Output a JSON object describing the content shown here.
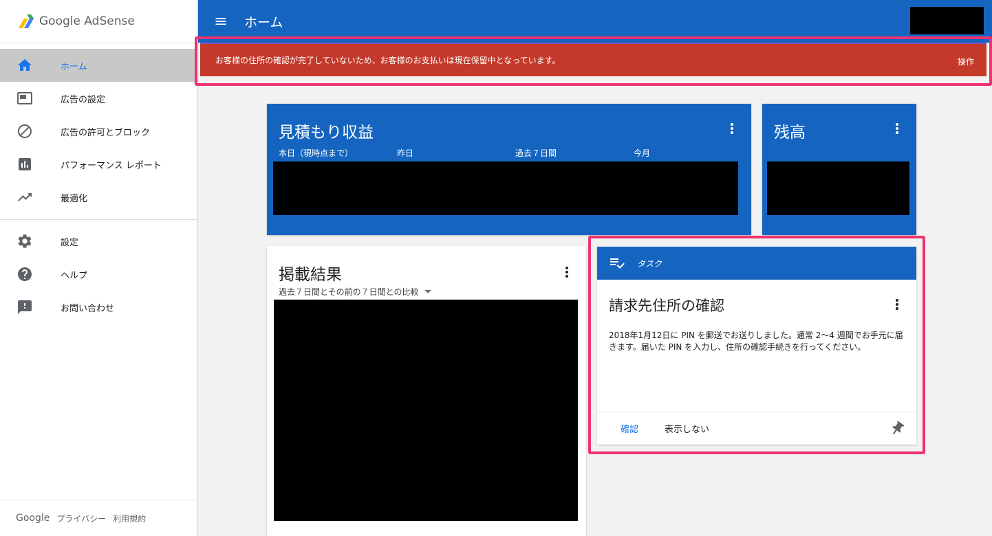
{
  "app": {
    "name": "Google AdSense"
  },
  "sidebar": {
    "items": [
      {
        "label": "ホーム",
        "icon": "home-icon",
        "active": true
      },
      {
        "label": "広告の設定",
        "icon": "ad-units-icon"
      },
      {
        "label": "広告の許可とブロック",
        "icon": "block-icon"
      },
      {
        "label": "パフォーマンス レポート",
        "icon": "bar-chart-icon"
      },
      {
        "label": "最適化",
        "icon": "trending-up-icon"
      },
      {
        "label": "設定",
        "icon": "gear-icon"
      },
      {
        "label": "ヘルプ",
        "icon": "help-icon"
      },
      {
        "label": "お問い合わせ",
        "icon": "feedback-icon"
      }
    ],
    "footer": {
      "google": "Google",
      "privacy": "プライバシー",
      "terms": "利用規約"
    }
  },
  "header": {
    "title": "ホーム"
  },
  "alert": {
    "text": "お客様の住所の確認が完了していないため、お客様のお支払いは現在保留中となっています。",
    "action": "操作",
    "color": "#c5392a"
  },
  "cards": {
    "estimated": {
      "title": "見積もり収益",
      "columns": [
        "本日（現時点まで）",
        "昨日",
        "過去７日間",
        "今月"
      ]
    },
    "balance": {
      "title": "残高"
    },
    "performance": {
      "title": "掲載結果",
      "subtitle": "過去７日間とその前の７日間との比較"
    },
    "task": {
      "header": "タスク",
      "title": "請求先住所の確認",
      "body": "2018年1月12日に PIN を郵送でお送りしました。通常 2〜4 週間でお手元に届きます。届いた PIN を入力し、住所の確認手続きを行ってください。",
      "confirm": "確認",
      "dismiss": "表示しない"
    }
  },
  "colors": {
    "primary": "#1565c0",
    "highlight": "#f0326f",
    "link": "#1a73e8"
  }
}
